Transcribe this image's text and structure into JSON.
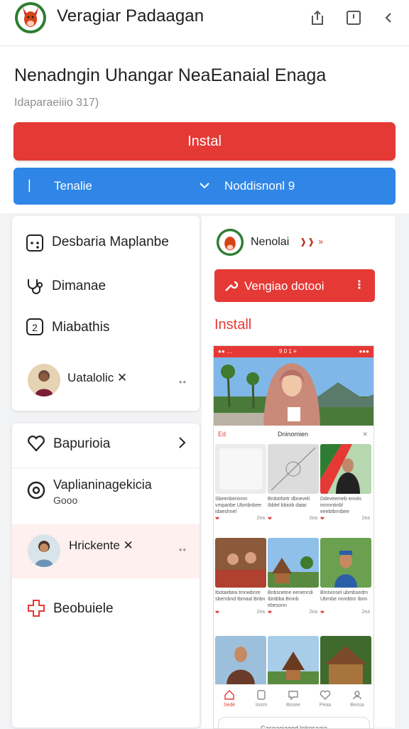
{
  "header": {
    "app_title": "Veragiar Padaagan",
    "icons": [
      "logo-icon",
      "share-icon",
      "bookmark-icon",
      "back-icon"
    ]
  },
  "hero": {
    "title": "Nenadngin Uhangar NeaEanaial Enaga",
    "subtitle": "Idaparaeiiio 317)",
    "install_label": "Instal",
    "select": {
      "left_label": "Tenalie",
      "right_label": "Noddisnonl 9"
    }
  },
  "card1": {
    "items": [
      {
        "label": "Desbaria Maplanbe",
        "icon": "dice-icon"
      },
      {
        "label": "Dimanae",
        "icon": "stethoscope-icon"
      },
      {
        "label": "Miabathis",
        "icon": "number-two-icon"
      },
      {
        "label": "Uatalolic ✕",
        "icon": "avatar"
      }
    ],
    "dots": "••"
  },
  "card2": {
    "items": [
      {
        "label": "Bapurioia",
        "icon": "heart-icon"
      },
      {
        "label": "Vaplianinagekicia",
        "sublabel": "Gooo",
        "icon": "circle-icon"
      },
      {
        "label": "Hrickente ✕",
        "icon": "avatar"
      },
      {
        "label": "Beobuiele",
        "icon": "medical-cross-icon"
      }
    ],
    "dots": "••"
  },
  "preview": {
    "app_name": "Nenolai",
    "tags": "❱❱ »",
    "button_label": "Vengiao dotooi",
    "button_dots": "⋮",
    "install_label": "Install",
    "phone": {
      "status": "●● …",
      "status_center": "9 0 1 ≡",
      "status_right": "●●●",
      "section_left": "Ed",
      "section_title": "Dninomien",
      "section_close": "✕",
      "tiles": [
        {
          "caption": "Sbeenbeninnn vmpanbe Ubmbnbee idaeshnel",
          "count": "2ea"
        },
        {
          "caption": "Brdotrbetr dbneveli Ibblel bbioib daiar",
          "count": "2ea"
        },
        {
          "caption": "Ddeveemeb enniis imnnntinbl eeebtbrnibee",
          "count": "2ea"
        },
        {
          "caption": "Ibotaebea tmnwbnre sbernbnd tbmaal Bnbn",
          "count": "2ea"
        },
        {
          "caption": "Bnbsnetne eenenrsli Ibntbba Bmnb ebesonn",
          "count": "2ea"
        },
        {
          "caption": "Bmtvinsel ubmbsedm Ubrnbe nnmbtnr Ibnn",
          "count": "2ea"
        }
      ],
      "nav": [
        "Sede",
        "Iixsm",
        "Bosee",
        "Peaa",
        "Bessa"
      ],
      "footer": "Caseaeiaeod Inkesaaia"
    }
  }
}
